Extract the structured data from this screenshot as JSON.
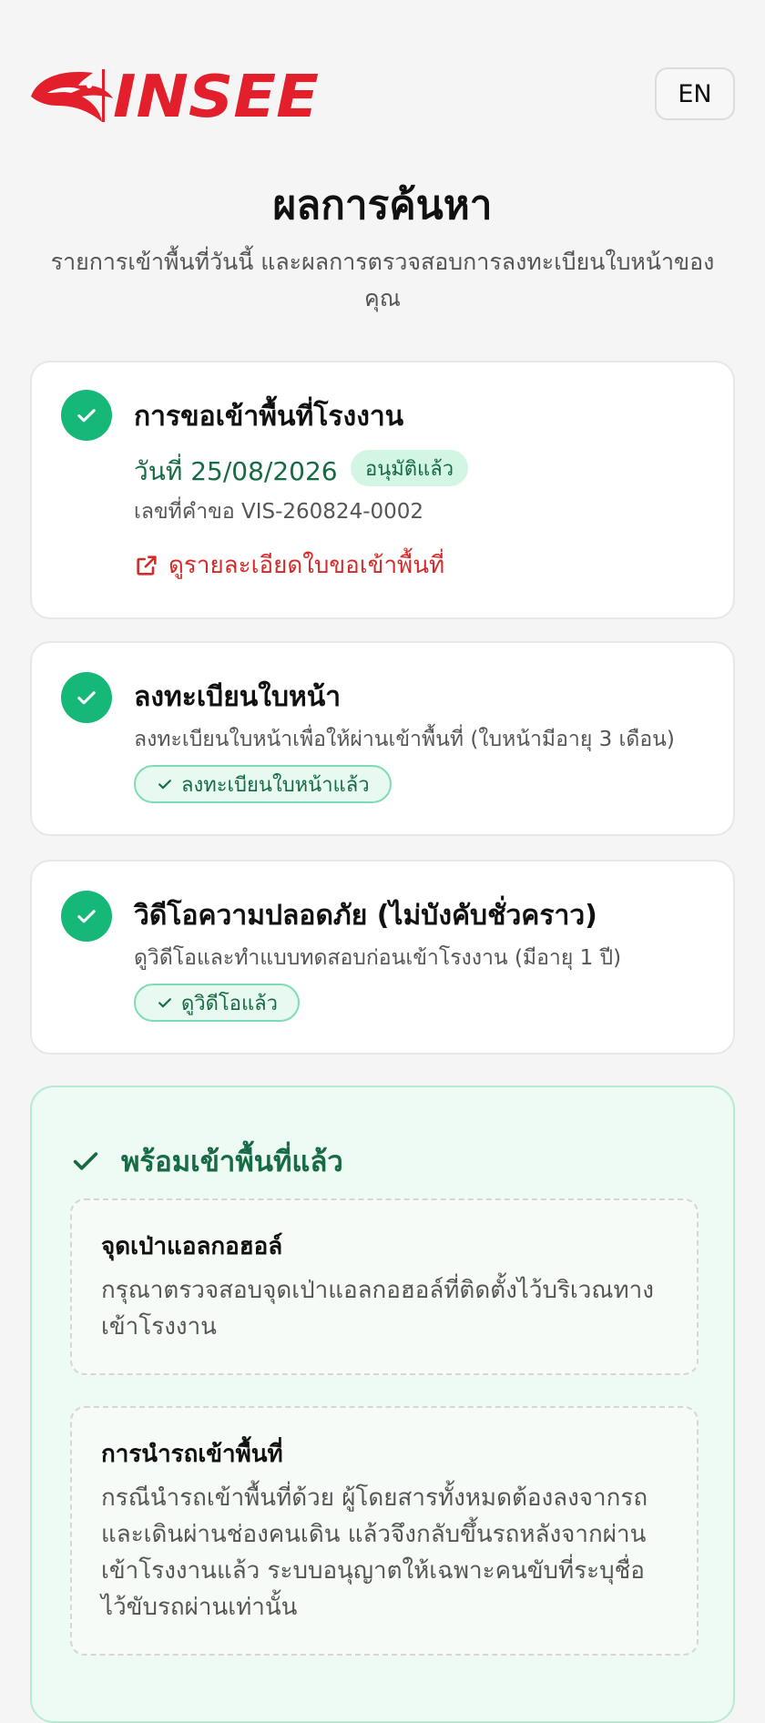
{
  "header": {
    "logo_text": "INSEE",
    "lang_button": "EN",
    "brand_color": "#e21f2a"
  },
  "page": {
    "title": "ผลการค้นหา",
    "subtitle": "รายการเข้าพื้นที่วันนี้ และผลการตรวจสอบการลงทะเบียนใบหน้าของคุณ"
  },
  "cards": {
    "visit": {
      "title": "การขอเข้าพื้นที่โรงงาน",
      "date": "วันที่ 25/08/2026",
      "status": "อนุมัติแล้ว",
      "request_no": "เลขที่คำขอ VIS-260824-0002",
      "link": "ดูรายละเอียดใบขอเข้าพื้นที่",
      "link_icon": "external-link-icon"
    },
    "face": {
      "title": "ลงทะเบียนใบหน้า",
      "desc": "ลงทะเบียนใบหน้าเพื่อให้ผ่านเข้าพื้นที่ (ใบหน้ามีอายุ 3 เดือน)",
      "pill": "ลงทะเบียนใบหน้าแล้ว"
    },
    "video": {
      "title": "วิดีโอความปลอดภัย (ไม่บังคับชั่วคราว)",
      "desc": "ดูวิดีโอและทำแบบทดสอบก่อนเข้าโรงงาน (มีอายุ 1 ปี)",
      "pill": "ดูวิดีโอแล้ว"
    }
  },
  "ready": {
    "title": "พร้อมเข้าพื้นที่แล้ว",
    "notices": [
      {
        "title": "จุดเป่าแอลกอฮอล์",
        "body": "กรุณาตรวจสอบจุดเป่าแอลกอฮอล์ที่ติดตั้งไว้บริเวณทางเข้าโรงงาน"
      },
      {
        "title": "การนำรถเข้าพื้นที่",
        "body": "กรณีนำรถเข้าพื้นที่ด้วย ผู้โดยสารทั้งหมดต้องลงจากรถและเดินผ่านช่องคนเดิน แล้วจึงกลับขึ้นรถหลังจากผ่านเข้าโรงงานแล้ว ระบบอนุญาตให้เฉพาะคนขับที่ระบุชื่อไว้ขับรถผ่านเท่านั้น"
      }
    ]
  },
  "colors": {
    "success": "#16b877",
    "success_dark": "#166a44",
    "link_red": "#d42a2a"
  }
}
